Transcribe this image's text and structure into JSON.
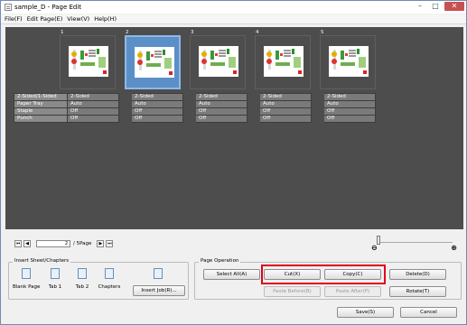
{
  "window": {
    "title": "sample_D - Page Edit",
    "controls": [
      "–",
      "□",
      "✕"
    ]
  },
  "menu": [
    "File(F)",
    "Edit Page(E)",
    "View(V)",
    "Help(H)"
  ],
  "pages": [
    {
      "number": "1",
      "selected": false
    },
    {
      "number": "2",
      "selected": true
    },
    {
      "number": "3",
      "selected": false
    },
    {
      "number": "4",
      "selected": false
    },
    {
      "number": "5",
      "selected": false
    }
  ],
  "settings": {
    "labels": [
      "2-Sided/1-Sided",
      "Paper Tray",
      "Staple",
      "Punch"
    ],
    "values": [
      "2-Sided",
      "Auto",
      "Off",
      "Off"
    ]
  },
  "nav": {
    "first": "⏮",
    "prev": "◀",
    "current_page": "2",
    "page_count": "/ 5Page",
    "next": "▶",
    "last": "⏭"
  },
  "zoom": {
    "minus": "⊖",
    "plus": "⊕",
    "level": 0.02
  },
  "insert_group": {
    "legend": "Insert Sheet/Chapters",
    "items": [
      "Blank Page",
      "Tab 1",
      "Tab 2",
      "Chapters"
    ],
    "insert_job": "Insert Job(R)..."
  },
  "page_operation": {
    "legend": "Page Operation",
    "select_all": "Select All(A)",
    "cut": "Cut(X)",
    "copy": "Copy(C)",
    "delete": "Delete(D)",
    "paste_before": "Paste Before(B)",
    "paste_after": "Paste After(P)",
    "rotate": "Rotate(T)"
  },
  "footer": {
    "save": "Save(S)",
    "cancel": "Cancel"
  },
  "colors": {
    "canvas": "#4d4d4d",
    "selected": "#5b8fc7",
    "highlight": "#e0001a"
  }
}
